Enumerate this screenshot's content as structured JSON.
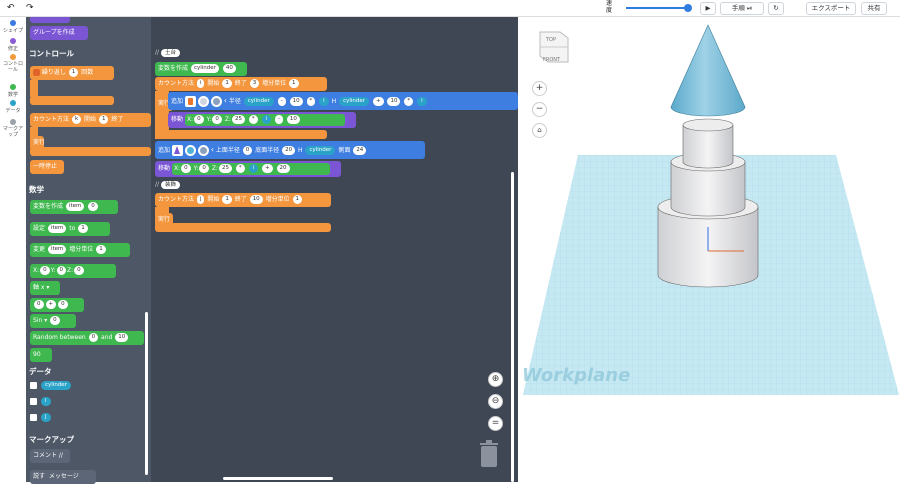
{
  "topbar": {
    "speed_label": "速度",
    "step_label": "手順",
    "export_label": "エクスポート",
    "share_label": "共有",
    "undo_icon": "undo-icon",
    "redo_icon": "redo-icon"
  },
  "categories": [
    {
      "label": "シェイプ",
      "color": "#3b7be0"
    },
    {
      "label": "修正",
      "color": "#8a5cd6"
    },
    {
      "label": "コントロール",
      "color": "#f09a3a"
    },
    {
      "label": "数学",
      "color": "#3fb84f"
    },
    {
      "label": "データ",
      "color": "#2ba3c8"
    },
    {
      "label": "マークアップ",
      "color": "#9aa1a8"
    }
  ],
  "flyout": {
    "create_group": "グループを作成",
    "control_heading": "コントロール",
    "repeat": {
      "label": "繰り返し",
      "count": "1",
      "unit": "回数"
    },
    "count_with": {
      "label": "カウント方法",
      "var": "k",
      "start_label": "開始",
      "start": "1",
      "end_label": "終了"
    },
    "do_label": "実行",
    "pause": "一時停止",
    "math_heading": "数学",
    "create_var": {
      "label": "変数を作成",
      "var": "item",
      "value": "0"
    },
    "set": {
      "label": "設定",
      "var": "item",
      "to": "to",
      "value": "1"
    },
    "change": {
      "label": "変更",
      "var": "item",
      "by": "増分単位",
      "value": "1"
    },
    "xyz": {
      "x": "X:",
      "xv": "0",
      "y": "Y:",
      "yv": "0",
      "z": "Z:",
      "zv": "0"
    },
    "axis": "軸 x",
    "arith": {
      "a": "0",
      "op": "+",
      "b": "0"
    },
    "sin": {
      "label": "Sin",
      "value": "0"
    },
    "random": {
      "label": "Random between",
      "a": "0",
      "and": "and",
      "b": "10"
    },
    "angle": "90",
    "data_heading": "データ",
    "data_vars": [
      "cylinder",
      "i",
      "j"
    ],
    "markup_heading": "マークアップ",
    "comment": "コメント //",
    "bottom": [
      "説す",
      "メッセージ"
    ]
  },
  "workspace": {
    "comment1": "土台",
    "var_create": {
      "label": "変数を作成",
      "var": "cylinder",
      "value": "40"
    },
    "count1": {
      "label": "カウント方法",
      "var": "i",
      "start_label": "開始",
      "start": "1",
      "end_label": "終了",
      "end": "3",
      "step_label": "増分単位",
      "step": "1"
    },
    "do_label": "実行",
    "add_label": "追加",
    "move_label": "移動",
    "radius_label": "半径",
    "h_label": "H",
    "add1": {
      "radius_var": "cylinder",
      "op1": "-",
      "val1": "10",
      "op2": "*",
      "i": "i",
      "h_var": "cylinder",
      "op3": "+",
      "val3": "10",
      "op4": "*",
      "i2": "i"
    },
    "move1": {
      "x": "X:",
      "xv": "0",
      "y": "Y:",
      "yv": "0",
      "z": "Z:",
      "zv": "25",
      "op": "*",
      "i": "i",
      "op2": "-",
      "val": "10"
    },
    "add2": {
      "top_r_label": "上面半径",
      "top_r": "0",
      "bot_r_label": "底面半径",
      "bot_r": "20",
      "h_label": "H",
      "h_var": "cylinder",
      "side_label": "側面",
      "side": "24"
    },
    "move2": {
      "x": "X:",
      "xv": "0",
      "y": "Y:",
      "yv": "0",
      "z": "Z:",
      "zv": "25",
      "op": "*",
      "i": "i",
      "op2": "+",
      "val": "20"
    },
    "comment2": "装飾",
    "count2": {
      "label": "カウント方法",
      "var": "j",
      "start_label": "開始",
      "start": "1",
      "end_label": "終了",
      "end": "10",
      "step_label": "増分単位",
      "step": "1"
    }
  },
  "viewport": {
    "cube_top": "TOP",
    "cube_front": "FRONT",
    "workplane_label": "Workplane",
    "accent": "#7bc5e0"
  }
}
